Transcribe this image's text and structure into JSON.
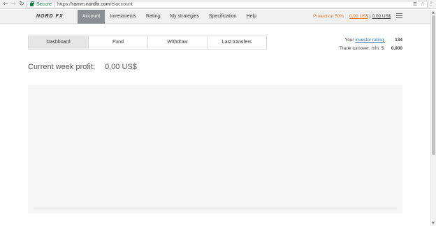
{
  "browser": {
    "secure_label": "Secure",
    "url_scheme": "https://",
    "url_domain": "ramm.nordfx.com",
    "url_path": "/e/account",
    "icons": [
      "back-icon",
      "forward-icon",
      "reload-icon",
      "lock-icon",
      "key-icon",
      "star-icon",
      "menu-icon"
    ]
  },
  "header": {
    "logo": "NORD FX",
    "nav": [
      {
        "label": "Account",
        "active": true
      },
      {
        "label": "Investments"
      },
      {
        "label": "Rating"
      },
      {
        "label": "My strategies"
      },
      {
        "label": "Specification"
      },
      {
        "label": "Help"
      }
    ],
    "protection": "Protection 50%",
    "balance_primary": "0,00 US$",
    "balance_separator": "|",
    "balance_secondary": "0,00 US$"
  },
  "tabs": [
    {
      "label": "Dashboard",
      "active": true
    },
    {
      "label": "Fund"
    },
    {
      "label": "Withdraw"
    },
    {
      "label": "Last transfers"
    }
  ],
  "investor": {
    "rating_prefix": "Your",
    "rating_link": "investor rating:",
    "rating_value": "134",
    "turnover_label": "Trade turnover, mln. $:",
    "turnover_value": "0,000"
  },
  "profit": {
    "label": "Current week profit:",
    "value": "0,00 US$"
  },
  "colors": {
    "accent_orange": "#e8843c",
    "active_nav": "#8b8f93",
    "link_blue": "#2d6fb4",
    "secure_green": "#0b8043"
  }
}
